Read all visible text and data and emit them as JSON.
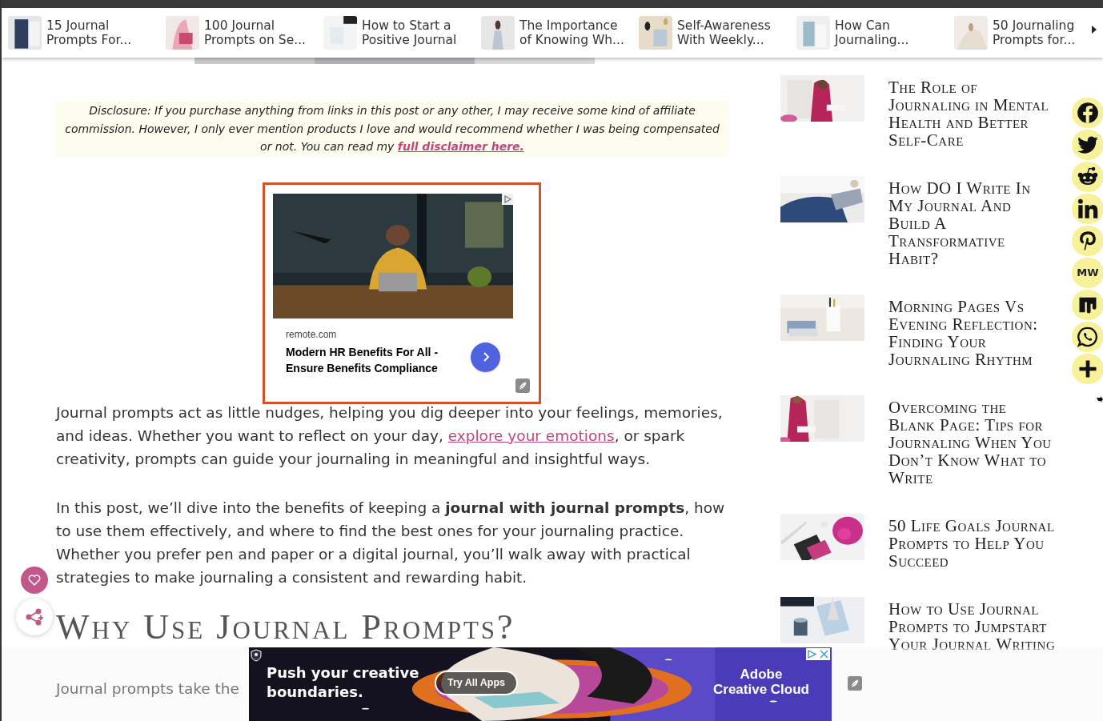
{
  "related_bar": {
    "items": [
      {
        "lines": [
          "15 Journal",
          "Prompts For..."
        ]
      },
      {
        "lines": [
          "100 Journal",
          "Prompts on Se..."
        ]
      },
      {
        "lines": [
          "How to Start a",
          "Positive Journal"
        ]
      },
      {
        "lines": [
          "The Importance",
          "of Knowing Wh..."
        ]
      },
      {
        "lines": [
          "Self-Awareness",
          "With Weekly..."
        ]
      },
      {
        "lines": [
          "How Can",
          "Journaling..."
        ]
      },
      {
        "lines": [
          "50 Journaling",
          "Prompts for..."
        ]
      }
    ]
  },
  "article": {
    "disclosure": {
      "text": "Disclosure: If you purchase anything from links in this post or any other, I may receive some kind of affiliate commission. However, I only ever mention products I love and would recommend whether I was being compensated or not. You can read my",
      "link": "full disclaimer here."
    },
    "ad": {
      "source": "remote.com",
      "headline": "Modern HR Benefits For All - Ensure Benefits Compliance"
    },
    "paragraphs": [
      {
        "segments": [
          {
            "kind": "text",
            "text": "Journal prompts act as little nudges, helping you dig deeper into your feelings, memories, and ideas. Whether you want to reflect on your day, "
          },
          {
            "kind": "link",
            "text": "explore your emotions"
          },
          {
            "kind": "text",
            "text": ", or spark creativity, prompts can guide your journaling in meaningful and insightful ways."
          }
        ]
      },
      {
        "segments": [
          {
            "kind": "text",
            "text": "In this post, we’ll dive into the benefits of keeping a **journal with journal prompts**, how to use them effectively, and where to find the best ones for your journaling practice. Whether you prefer pen and paper or a digital journal, you’ll walk away with practical strategies to make journaling a consistent and rewarding habit."
          }
        ]
      }
    ],
    "heading": "Why Use Journal Prompts?",
    "next_paragraph": "Journal prompts take the"
  },
  "sidebar": {
    "posts": [
      {
        "title": "The Role of Journaling in Mental Health and Better Self-Care"
      },
      {
        "title": "How DO I Write In My Journal And Build A Transformative Habit?"
      },
      {
        "title": "Morning Pages Vs Evening Reflection: Finding Your Journaling Rhythm"
      },
      {
        "title": "Overcoming the Blank Page: Tips for Journaling When You Don’t Know What to Write"
      },
      {
        "title": "50 Life Goals Journal Prompts to Help You Succeed"
      },
      {
        "title": "How to Use Journal Prompts to Jumpstart Your Journal Writing"
      }
    ]
  },
  "share_bar": {
    "buttons": [
      {
        "kind": "facebook"
      },
      {
        "kind": "twitter"
      },
      {
        "kind": "reddit"
      },
      {
        "kind": "linkedin"
      },
      {
        "kind": "pinterest"
      },
      {
        "kind": "mewe",
        "label": "MW"
      },
      {
        "kind": "mix"
      },
      {
        "kind": "whatsapp"
      },
      {
        "kind": "more"
      }
    ]
  },
  "bottom_ad": {
    "headline": "Push your creative boundaries.",
    "button": "Try All Apps",
    "brand_lines": [
      "Adobe",
      "Creative Cloud"
    ]
  }
}
